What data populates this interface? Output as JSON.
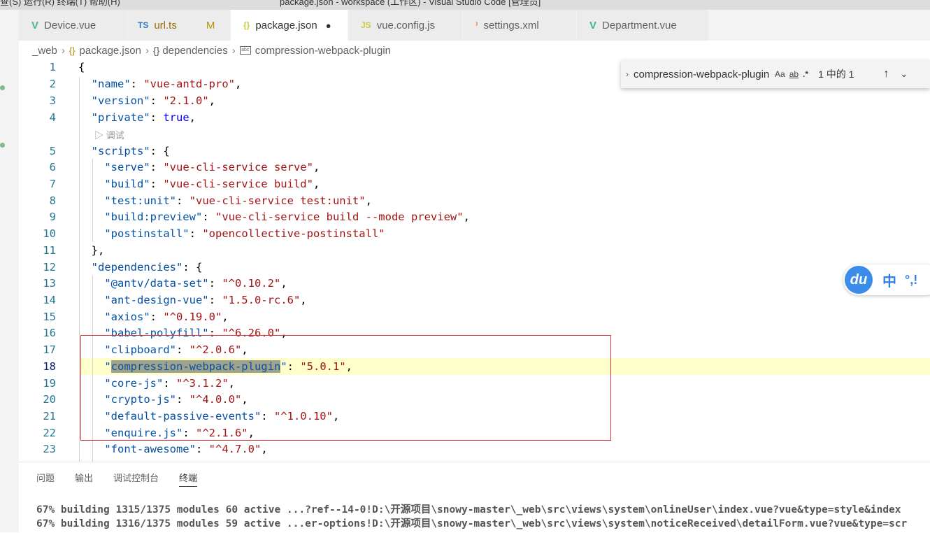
{
  "titlebar": {
    "left_text": "查(S)    运行(R)    终端(T)    帮助(H)",
    "center_text": "package.json - workspace (工作区) - Visual Studio Code [管理员]"
  },
  "tabs": [
    {
      "label": "Device.vue",
      "icon": "V",
      "icon_name": "vue-icon"
    },
    {
      "label": "url.ts",
      "icon": "TS",
      "icon_name": "ts-icon",
      "status": "M"
    },
    {
      "label": "package.json",
      "icon": "{}",
      "icon_name": "json-icon",
      "dirty": "●",
      "active": true
    },
    {
      "label": "vue.config.js",
      "icon": "JS",
      "icon_name": "js-icon"
    },
    {
      "label": "settings.xml",
      "icon": "⁾",
      "icon_name": "rss-icon"
    },
    {
      "label": "Department.vue",
      "icon": "V",
      "icon_name": "vue-icon"
    }
  ],
  "breadcrumb": {
    "items": [
      "_web",
      "package.json",
      "dependencies",
      "compression-webpack-plugin"
    ],
    "icons": [
      "",
      "{}",
      "{}",
      "abc"
    ]
  },
  "find_widget": {
    "value": "compression-webpack-plugin",
    "match_case": "Aa",
    "whole_word": "ab",
    "regex": ".*",
    "count": "1 中的 1"
  },
  "codelens": "▷ 调试",
  "code_lines": [
    {
      "n": "1",
      "tokens": [
        {
          "t": "{",
          "c": ""
        }
      ]
    },
    {
      "n": "2",
      "tokens": [
        {
          "t": "  ",
          "c": ""
        },
        {
          "t": "\"name\"",
          "c": "k"
        },
        {
          "t": ": ",
          "c": ""
        },
        {
          "t": "\"vue-antd-pro\"",
          "c": "s"
        },
        {
          "t": ",",
          "c": ""
        }
      ]
    },
    {
      "n": "3",
      "tokens": [
        {
          "t": "  ",
          "c": ""
        },
        {
          "t": "\"version\"",
          "c": "k"
        },
        {
          "t": ": ",
          "c": ""
        },
        {
          "t": "\"2.1.0\"",
          "c": "s"
        },
        {
          "t": ",",
          "c": ""
        }
      ]
    },
    {
      "n": "4",
      "tokens": [
        {
          "t": "  ",
          "c": ""
        },
        {
          "t": "\"private\"",
          "c": "k"
        },
        {
          "t": ": ",
          "c": ""
        },
        {
          "t": "true",
          "c": "b"
        },
        {
          "t": ",",
          "c": ""
        }
      ]
    },
    {
      "n": "5",
      "tokens": [
        {
          "t": "  ",
          "c": ""
        },
        {
          "t": "\"scripts\"",
          "c": "k"
        },
        {
          "t": ": {",
          "c": ""
        }
      ]
    },
    {
      "n": "6",
      "tokens": [
        {
          "t": "    ",
          "c": ""
        },
        {
          "t": "\"serve\"",
          "c": "k"
        },
        {
          "t": ": ",
          "c": ""
        },
        {
          "t": "\"vue-cli-service serve\"",
          "c": "s"
        },
        {
          "t": ",",
          "c": ""
        }
      ]
    },
    {
      "n": "7",
      "tokens": [
        {
          "t": "    ",
          "c": ""
        },
        {
          "t": "\"build\"",
          "c": "k"
        },
        {
          "t": ": ",
          "c": ""
        },
        {
          "t": "\"vue-cli-service build\"",
          "c": "s"
        },
        {
          "t": ",",
          "c": ""
        }
      ]
    },
    {
      "n": "8",
      "tokens": [
        {
          "t": "    ",
          "c": ""
        },
        {
          "t": "\"test:unit\"",
          "c": "k"
        },
        {
          "t": ": ",
          "c": ""
        },
        {
          "t": "\"vue-cli-service test:unit\"",
          "c": "s"
        },
        {
          "t": ",",
          "c": ""
        }
      ]
    },
    {
      "n": "9",
      "tokens": [
        {
          "t": "    ",
          "c": ""
        },
        {
          "t": "\"build:preview\"",
          "c": "k"
        },
        {
          "t": ": ",
          "c": ""
        },
        {
          "t": "\"vue-cli-service build --mode preview\"",
          "c": "s"
        },
        {
          "t": ",",
          "c": ""
        }
      ]
    },
    {
      "n": "10",
      "tokens": [
        {
          "t": "    ",
          "c": ""
        },
        {
          "t": "\"postinstall\"",
          "c": "k"
        },
        {
          "t": ": ",
          "c": ""
        },
        {
          "t": "\"opencollective-postinstall\"",
          "c": "s"
        }
      ]
    },
    {
      "n": "11",
      "tokens": [
        {
          "t": "  },",
          "c": ""
        }
      ]
    },
    {
      "n": "12",
      "tokens": [
        {
          "t": "  ",
          "c": ""
        },
        {
          "t": "\"dependencies\"",
          "c": "k"
        },
        {
          "t": ": {",
          "c": ""
        }
      ]
    },
    {
      "n": "13",
      "tokens": [
        {
          "t": "    ",
          "c": ""
        },
        {
          "t": "\"@antv/data-set\"",
          "c": "k"
        },
        {
          "t": ": ",
          "c": ""
        },
        {
          "t": "\"^0.10.2\"",
          "c": "s"
        },
        {
          "t": ",",
          "c": ""
        }
      ]
    },
    {
      "n": "14",
      "tokens": [
        {
          "t": "    ",
          "c": ""
        },
        {
          "t": "\"ant-design-vue\"",
          "c": "k"
        },
        {
          "t": ": ",
          "c": ""
        },
        {
          "t": "\"1.5.0-rc.6\"",
          "c": "s"
        },
        {
          "t": ",",
          "c": ""
        }
      ]
    },
    {
      "n": "15",
      "tokens": [
        {
          "t": "    ",
          "c": ""
        },
        {
          "t": "\"axios\"",
          "c": "k"
        },
        {
          "t": ": ",
          "c": ""
        },
        {
          "t": "\"^0.19.0\"",
          "c": "s"
        },
        {
          "t": ",",
          "c": ""
        }
      ]
    },
    {
      "n": "16",
      "tokens": [
        {
          "t": "    ",
          "c": ""
        },
        {
          "t": "\"babel-polyfill\"",
          "c": "k"
        },
        {
          "t": ": ",
          "c": ""
        },
        {
          "t": "\"^6.26.0\"",
          "c": "s"
        },
        {
          "t": ",",
          "c": ""
        }
      ]
    },
    {
      "n": "17",
      "tokens": [
        {
          "t": "    ",
          "c": ""
        },
        {
          "t": "\"clipboard\"",
          "c": "k"
        },
        {
          "t": ": ",
          "c": ""
        },
        {
          "t": "\"^2.0.6\"",
          "c": "s"
        },
        {
          "t": ",",
          "c": ""
        }
      ]
    },
    {
      "n": "18",
      "current": true,
      "tokens": [
        {
          "t": "    ",
          "c": ""
        },
        {
          "t": "\"",
          "c": "k"
        },
        {
          "t": "compression-webpack-plugin",
          "c": "k match"
        },
        {
          "t": "\"",
          "c": "k"
        },
        {
          "t": ": ",
          "c": ""
        },
        {
          "t": "\"5.0.1\"",
          "c": "s"
        },
        {
          "t": ",",
          "c": ""
        }
      ]
    },
    {
      "n": "19",
      "tokens": [
        {
          "t": "    ",
          "c": ""
        },
        {
          "t": "\"core-js\"",
          "c": "k"
        },
        {
          "t": ": ",
          "c": ""
        },
        {
          "t": "\"^3.1.2\"",
          "c": "s"
        },
        {
          "t": ",",
          "c": ""
        }
      ]
    },
    {
      "n": "20",
      "tokens": [
        {
          "t": "    ",
          "c": ""
        },
        {
          "t": "\"crypto-js\"",
          "c": "k"
        },
        {
          "t": ": ",
          "c": ""
        },
        {
          "t": "\"^4.0.0\"",
          "c": "s"
        },
        {
          "t": ",",
          "c": ""
        }
      ]
    },
    {
      "n": "21",
      "tokens": [
        {
          "t": "    ",
          "c": ""
        },
        {
          "t": "\"default-passive-events\"",
          "c": "k"
        },
        {
          "t": ": ",
          "c": ""
        },
        {
          "t": "\"^1.0.10\"",
          "c": "s"
        },
        {
          "t": ",",
          "c": ""
        }
      ]
    },
    {
      "n": "22",
      "tokens": [
        {
          "t": "    ",
          "c": ""
        },
        {
          "t": "\"enquire.js\"",
          "c": "k"
        },
        {
          "t": ": ",
          "c": ""
        },
        {
          "t": "\"^2.1.6\"",
          "c": "s"
        },
        {
          "t": ",",
          "c": ""
        }
      ]
    },
    {
      "n": "23",
      "tokens": [
        {
          "t": "    ",
          "c": ""
        },
        {
          "t": "\"font-awesome\"",
          "c": "k"
        },
        {
          "t": ": ",
          "c": ""
        },
        {
          "t": "\"^4.7.0\"",
          "c": "s"
        },
        {
          "t": ",",
          "c": ""
        }
      ]
    }
  ],
  "ime": {
    "logo": "du",
    "mode": "中",
    "punct": "°,!"
  },
  "panel": {
    "tabs": [
      "问题",
      "输出",
      "调试控制台",
      "终端"
    ],
    "active_tab": "终端",
    "terminal_lines": [
      "67% building 1315/1375 modules 60 active ...?ref--14-0!D:\\开源项目\\snowy-master\\_web\\src\\views\\system\\onlineUser\\index.vue?vue&type=style&index",
      "67% building 1316/1375 modules 59 active ...er-options!D:\\开源项目\\snowy-master\\_web\\src\\views\\system\\noticeReceived\\detailForm.vue?vue&type=scr"
    ]
  },
  "colors": {
    "key": "#0451a5",
    "string": "#a31515",
    "bool": "#0000ff",
    "line_highlight": "#ffffcc",
    "annotation_box": "#d9363e"
  }
}
